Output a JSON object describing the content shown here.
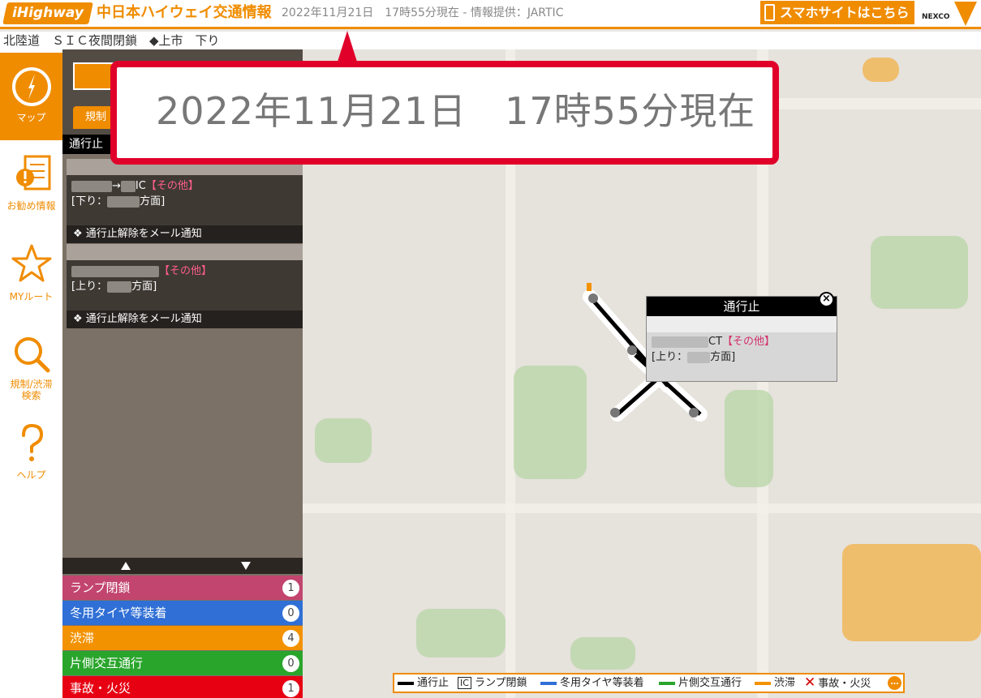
{
  "header": {
    "logo_text": "iHighway",
    "title": "中日本ハイウェイ交通情報",
    "date_line": "2022年11月21日　17時55分現在 - 情報提供：JARTIC",
    "smartphone_button": "スマホサイトはこちら",
    "nexco_text": "NEXCO"
  },
  "route_bar": {
    "text": "北陸道　ＳＩＣ夜間閉鎖　◆上市　下り"
  },
  "nav": {
    "items": [
      {
        "label": "マップ"
      },
      {
        "label": "お勧め情報"
      },
      {
        "label": "MYルート"
      },
      {
        "label": "規制/渋滞検索"
      },
      {
        "label": "ヘルプ"
      }
    ]
  },
  "sidebar": {
    "tab_label": "規制",
    "list_header": "通行止",
    "entries": [
      {
        "line1_mid": "→",
        "line1_suffix": "IC",
        "tag": "【その他】",
        "line2_prefix": "[下り：",
        "line2_suffix": "方面]",
        "notify": "通行止解除をメール通知"
      },
      {
        "tag": "【その他】",
        "line2_prefix": "[上り：",
        "line2_suffix": "方面]",
        "notify": "通行止解除をメール通知"
      }
    ],
    "categories": [
      {
        "label": "ランプ閉鎖",
        "count": "1",
        "color": "#c2456f"
      },
      {
        "label": "冬用タイヤ等装着",
        "count": "0",
        "color": "#2f6fd6"
      },
      {
        "label": "渋滞",
        "count": "4",
        "color": "#f39200"
      },
      {
        "label": "片側交互通行",
        "count": "0",
        "color": "#2aa52c"
      },
      {
        "label": "事故・火災",
        "count": "1",
        "color": "#e60012"
      }
    ]
  },
  "popup": {
    "title": "通行止",
    "line1_suffix": "CT",
    "tag": "【その他】",
    "line2_prefix": "[上り：",
    "line2_suffix": "方面]",
    "close_symbol": "×"
  },
  "legend": {
    "closure": "通行止",
    "ramp_icon": "IC",
    "ramp": "ランプ閉鎖",
    "winter_tires": "冬用タイヤ等装着",
    "alternating": "片側交互通行",
    "congestion": "渋滞",
    "accident": "事故・火災",
    "more_symbol": "…",
    "colors": {
      "closure": "#000000",
      "winter": "#2f6fd6",
      "alternating": "#2aa52c",
      "congestion": "#f39200",
      "accident": "#d20000"
    }
  },
  "callout": {
    "text": "2022年11月21日　17時55分現在"
  }
}
